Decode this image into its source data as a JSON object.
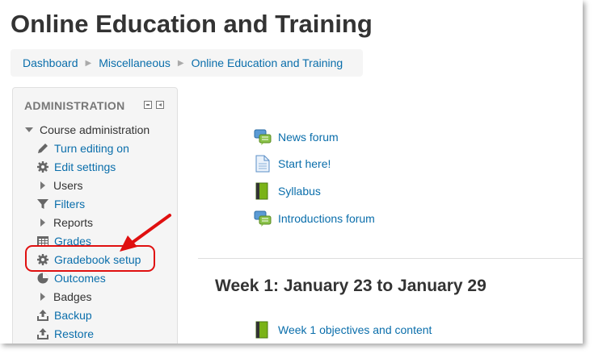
{
  "page": {
    "title": "Online Education and Training"
  },
  "breadcrumb": {
    "items": [
      {
        "label": "Dashboard"
      },
      {
        "label": "Miscellaneous"
      },
      {
        "label": "Online Education and Training"
      }
    ]
  },
  "admin_block": {
    "header": "ADMINISTRATION",
    "course_admin_label": "Course administration",
    "items": [
      {
        "label": "Turn editing on",
        "icon": "pencil-icon",
        "link": true
      },
      {
        "label": "Edit settings",
        "icon": "gear-icon",
        "link": true
      },
      {
        "label": "Users",
        "icon": "expand-triangle-icon",
        "link": false
      },
      {
        "label": "Filters",
        "icon": "filter-icon",
        "link": true
      },
      {
        "label": "Reports",
        "icon": "expand-triangle-icon",
        "link": false
      },
      {
        "label": "Grades",
        "icon": "grades-table-icon",
        "link": true
      },
      {
        "label": "Gradebook setup",
        "icon": "gear-icon",
        "link": true
      },
      {
        "label": "Outcomes",
        "icon": "outcomes-pie-icon",
        "link": true
      },
      {
        "label": "Badges",
        "icon": "expand-triangle-icon",
        "link": false
      },
      {
        "label": "Backup",
        "icon": "upload-icon",
        "link": true
      },
      {
        "label": "Restore",
        "icon": "upload-icon",
        "link": true
      }
    ]
  },
  "activities": [
    {
      "label": "News forum",
      "icon": "forum-icon"
    },
    {
      "label": "Start here!",
      "icon": "page-icon"
    },
    {
      "label": "Syllabus",
      "icon": "book-icon"
    },
    {
      "label": "Introductions forum",
      "icon": "forum-icon"
    }
  ],
  "week1": {
    "title": "Week 1: January 23 to January 29",
    "activities": [
      {
        "label": "Week 1 objectives and content",
        "icon": "book-icon"
      }
    ]
  },
  "colors": {
    "link": "#0a6eab",
    "highlight": "#e01010",
    "block_bg": "#f5f5f5",
    "forum_blue": "#5b9bd5",
    "book_green": "#7ab317"
  }
}
